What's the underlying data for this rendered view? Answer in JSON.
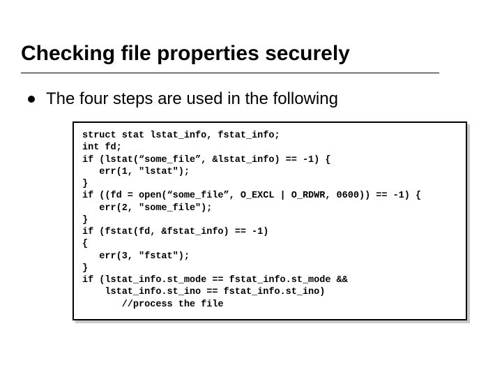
{
  "slide": {
    "title": "Checking file properties securely",
    "bullet": "The four steps are used in the following",
    "code_lines": [
      "struct stat lstat_info, fstat_info;",
      "int fd;",
      "if (lstat(“some_file”, &lstat_info) == -1) {",
      "   err(1, \"lstat\");",
      "}",
      "if ((fd = open(“some_file”, O_EXCL | O_RDWR, 0600)) == -1) {",
      "   err(2, \"some_file\");",
      "}",
      "if (fstat(fd, &fstat_info) == -1)",
      "{",
      "   err(3, \"fstat\");",
      "}",
      "if (lstat_info.st_mode == fstat_info.st_mode &&",
      "    lstat_info.st_ino == fstat_info.st_ino)",
      "       //process the file"
    ]
  }
}
